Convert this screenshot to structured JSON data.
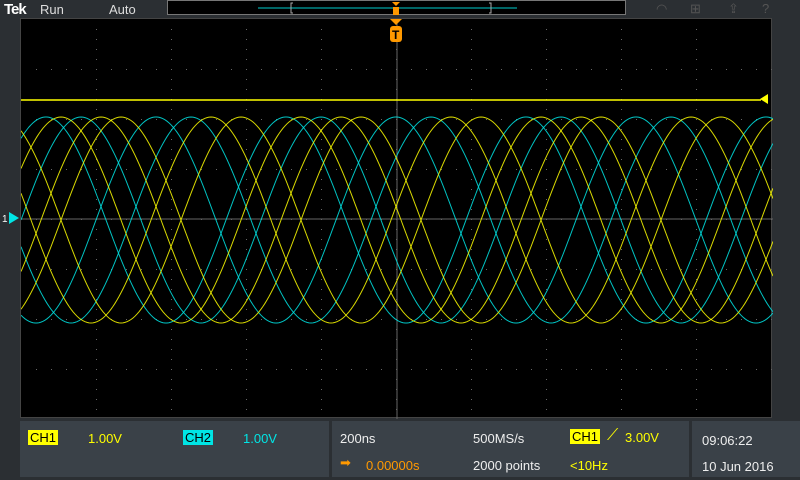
{
  "topbar": {
    "brand": "Tek",
    "run_state": "Run",
    "trigger_mode": "Auto",
    "icons": [
      "wifi-icon",
      "network-icon",
      "export-icon",
      "help-icon"
    ]
  },
  "colors": {
    "ch1": "#ffff00",
    "ch2": "#00e5e5",
    "trigger": "#ff9900",
    "grid": "#555555"
  },
  "channels": [
    {
      "label": "CH1",
      "scale": "1.00V"
    },
    {
      "label": "CH2",
      "scale": "1.00V"
    }
  ],
  "horizontal": {
    "time_scale": "200ns",
    "position": "0.00000s",
    "sample_rate": "500MS/s",
    "record_length": "2000 points"
  },
  "trigger": {
    "source": "CH1",
    "slope": "rising",
    "level": "3.00V",
    "frequency": "<10Hz",
    "marker": "T"
  },
  "ch1_marker": "1",
  "clock": {
    "time": "09:06:22",
    "date": "10 Jun 2016"
  }
}
